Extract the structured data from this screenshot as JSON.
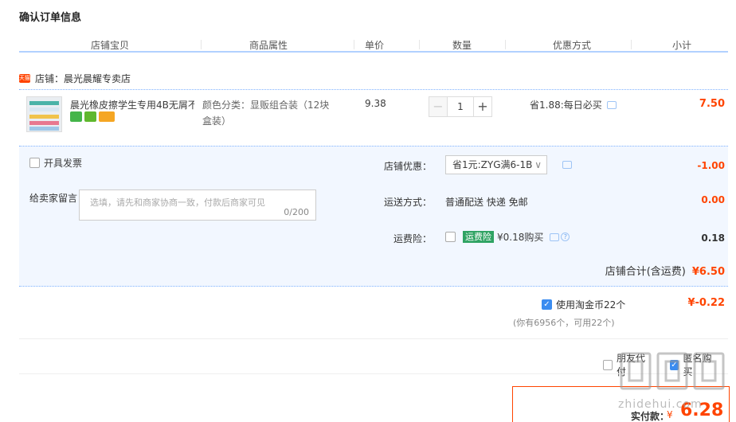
{
  "page": {
    "title": "确认订单信息"
  },
  "columns": [
    "店铺宝贝",
    "商品属性",
    "单价",
    "数量",
    "优惠方式",
    "小计"
  ],
  "shop": {
    "badge": "天猫",
    "name": "店铺：晨光晨耀专卖店"
  },
  "item": {
    "title": "晨光橡皮擦学生专用4B无屑不...",
    "attr": "颜色分类：显贩组合装（12块盒装）",
    "unit_price": "9.38",
    "quantity": "1",
    "minus": "−",
    "plus": "+",
    "discount": "省1.88:每日必买",
    "subtotal": "7.50"
  },
  "invoice": {
    "label": "开具发票"
  },
  "message": {
    "label": "给卖家留言：",
    "placeholder": "选填，请先和商家协商一致，付款后商家可见",
    "counter": "0/200"
  },
  "shop_coupon": {
    "label": "店铺优惠：",
    "selected": "省1元:ZYG满6-1B",
    "chevron": "∨",
    "value": "-1.00"
  },
  "shipping": {
    "label": "运送方式：",
    "method": "普通配送 快递 免邮",
    "value": "0.00"
  },
  "insurance": {
    "label": "运费险：",
    "tag": "运费险",
    "price": "¥0.18购买",
    "help": "?",
    "value": "0.18"
  },
  "shop_total": {
    "label": "店铺合计(含运费)",
    "value": "¥6.50"
  },
  "coins": {
    "label": "使用淘金币22个",
    "value": "¥-0.22",
    "note": "(你有6956个，可用22个)",
    "checkmark": "✓"
  },
  "options": {
    "friend_pay": "朋友代付",
    "anonymous": "匿名购买",
    "checkmark": "✓"
  },
  "payment": {
    "label": "实付款：",
    "currency": "¥",
    "amount": "6.28"
  },
  "watermark": {
    "text": "zhidehui.com"
  },
  "colors": {
    "accent": "#ff4400",
    "blue_line": "#80b2ff",
    "panel_bg": "#f2f7ff"
  }
}
